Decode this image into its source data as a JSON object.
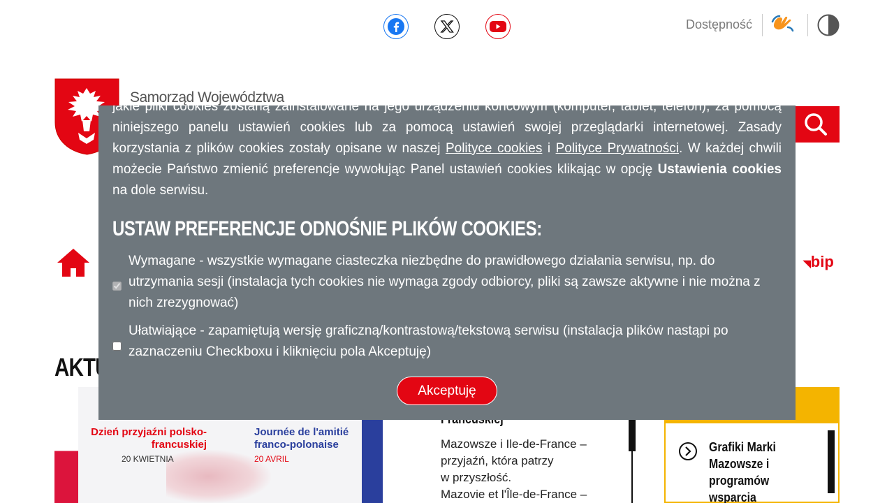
{
  "topbar": {
    "accessibility_label": "Dostępność",
    "social": [
      "facebook-icon",
      "x-icon",
      "youtube-icon"
    ]
  },
  "header": {
    "brand_text": "Samorząd Województwa",
    "bip_label": "bip"
  },
  "content": {
    "section_title": "AKTU",
    "news_image": {
      "pl_title": "Dzień przyjaźni polsko-francuskiej",
      "pl_date": "20 KWIETNIA",
      "fr_title": "Journée de l'amitié franco-polonaise",
      "fr_date": "20 AVRIL"
    },
    "article_title": "Francuskiej",
    "article_text": "Mazowsze i Ile-de-France –\n przyjaźń, która patrzy\nw przyszłość.\nMazovie et l'Île-de-France –",
    "sidebar_link": "Grafiki Marki Mazowsze i programów wsparcia (do"
  },
  "cookie": {
    "intro_part1": "jakie pliki cookies zostaną zainstalowane na jego urządzeniu końcowym (komputer, tablet, telefon), za pomocą niniejszego panelu ustawień cookies lub za pomocą ustawień swojej przeglądarki internetowej. Zasady korzystania z plików cookies zostały opisane w naszej ",
    "link_cookies": "Polityce cookies",
    "intro_part2": " i ",
    "link_privacy": "Polityce Prywatności",
    "intro_part3": ". W każdej chwili możecie Państwo zmienić preferencje wywołując Panel ustawień cookies klikając w opcję ",
    "settings_bold": "Ustawienia cookies",
    "intro_part4": " na dole serwisu.",
    "heading": "USTAW PREFERENCJE ODNOŚNIE PLIKÓW COOKIES:",
    "option_required": "Wymagane - wszystkie wymagane ciasteczka niezbędne do prawidłowego działania serwisu, np. do utrzymania sesji (instalacja tych cookies nie wymaga zgody odbiorcy, pliki są zawsze aktywne i nie można z nich zrezygnować)",
    "option_required_checked": true,
    "option_facilitating": "Ułatwiające - zapamiętują wersję graficzną/kontrastową/tekstową serwisu (instalacja plików nastąpi po zaznaczeniu Checkboxu i kliknięciu pola Akceptuję)",
    "option_facilitating_checked": false,
    "accept_label": "Akceptuję"
  },
  "colors": {
    "brand_red": "#e30613",
    "overlay_gray": "#6e777d",
    "accent_yellow": "#f4b400"
  }
}
